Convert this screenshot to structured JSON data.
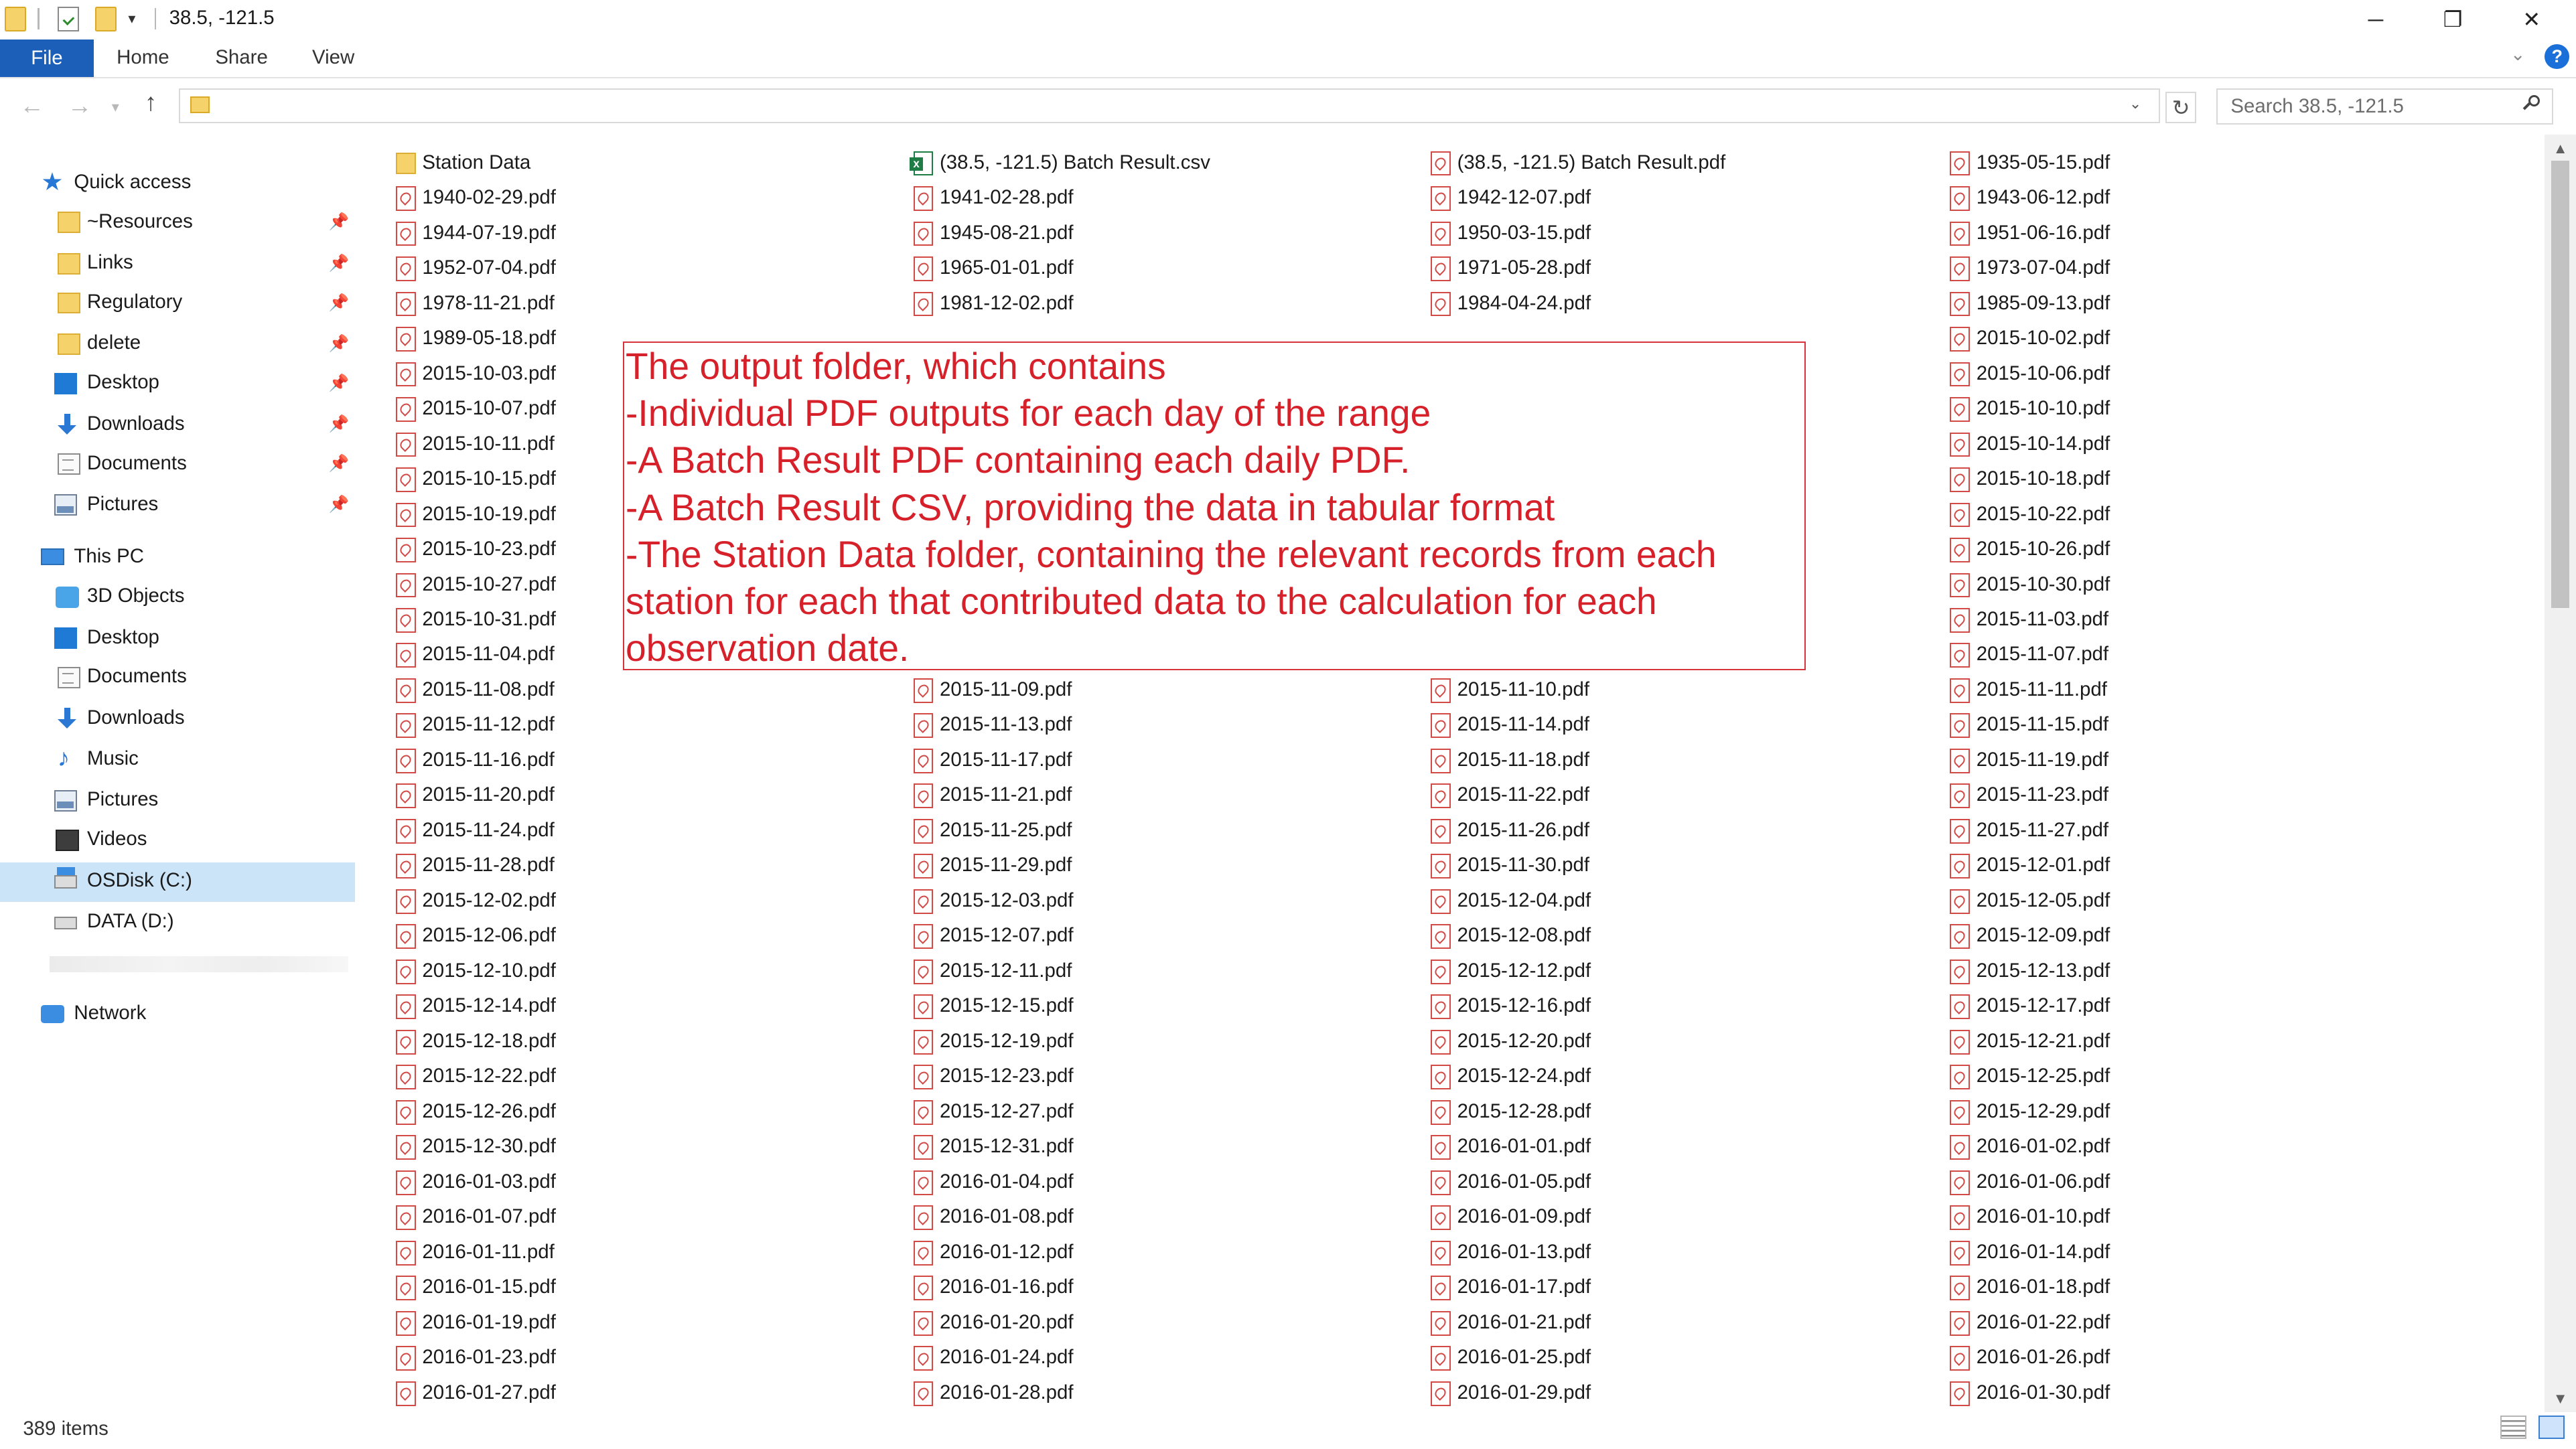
{
  "window": {
    "title": "38.5, -121.5",
    "quick_access_dropdown": "▾",
    "minimize": "─",
    "restore": "❐",
    "close": "✕"
  },
  "ribbon": {
    "file_tab": "File",
    "tabs": [
      "Home",
      "Share",
      "View"
    ],
    "help": "?"
  },
  "address": {
    "back": "←",
    "forward": "→",
    "recent": "▾",
    "up": "↑",
    "dropdown": "⌄",
    "refresh": "↻",
    "search_placeholder": "Search 38.5, -121.5"
  },
  "sidebar": {
    "quick_access": "Quick access",
    "pinned": [
      {
        "label": "~Resources",
        "icon": "folder-icon"
      },
      {
        "label": "Links",
        "icon": "folder-icon"
      },
      {
        "label": "Regulatory",
        "icon": "folder-icon"
      },
      {
        "label": "delete",
        "icon": "folder-icon"
      },
      {
        "label": "Desktop",
        "icon": "desktop-icon"
      },
      {
        "label": "Downloads",
        "icon": "downloads-icon"
      },
      {
        "label": "Documents",
        "icon": "documents-icon"
      },
      {
        "label": "Pictures",
        "icon": "pictures-icon"
      }
    ],
    "this_pc": "This PC",
    "pc_items": [
      {
        "label": "3D Objects",
        "icon": "3d-objects-icon"
      },
      {
        "label": "Desktop",
        "icon": "desktop-icon"
      },
      {
        "label": "Documents",
        "icon": "documents-icon"
      },
      {
        "label": "Downloads",
        "icon": "downloads-icon"
      },
      {
        "label": "Music",
        "icon": "music-icon"
      },
      {
        "label": "Pictures",
        "icon": "pictures-icon"
      },
      {
        "label": "Videos",
        "icon": "videos-icon"
      },
      {
        "label": "OSDisk (C:)",
        "icon": "drive-c-icon"
      },
      {
        "label": "DATA (D:)",
        "icon": "drive-icon"
      }
    ],
    "network": "Network",
    "pin_glyph": "📌"
  },
  "files": [
    [
      "Station Data",
      "(38.5, -121.5) Batch Result.csv",
      "(38.5, -121.5) Batch Result.pdf",
      "1935-05-15.pdf"
    ],
    [
      "1940-02-29.pdf",
      "1941-02-28.pdf",
      "1942-12-07.pdf",
      "1943-06-12.pdf"
    ],
    [
      "1944-07-19.pdf",
      "1945-08-21.pdf",
      "1950-03-15.pdf",
      "1951-06-16.pdf"
    ],
    [
      "1952-07-04.pdf",
      "1965-01-01.pdf",
      "1971-05-28.pdf",
      "1973-07-04.pdf"
    ],
    [
      "1978-11-21.pdf",
      "1981-12-02.pdf",
      "1984-04-24.pdf",
      "1985-09-13.pdf"
    ],
    [
      "1989-05-18.pdf",
      "",
      "",
      "2015-10-02.pdf"
    ],
    [
      "2015-10-03.pdf",
      "",
      "",
      "2015-10-06.pdf"
    ],
    [
      "2015-10-07.pdf",
      "",
      "",
      "2015-10-10.pdf"
    ],
    [
      "2015-10-11.pdf",
      "",
      "",
      "2015-10-14.pdf"
    ],
    [
      "2015-10-15.pdf",
      "",
      "",
      "2015-10-18.pdf"
    ],
    [
      "2015-10-19.pdf",
      "",
      "",
      "2015-10-22.pdf"
    ],
    [
      "2015-10-23.pdf",
      "",
      "",
      "2015-10-26.pdf"
    ],
    [
      "2015-10-27.pdf",
      "",
      "",
      "2015-10-30.pdf"
    ],
    [
      "2015-10-31.pdf",
      "",
      "",
      "2015-11-03.pdf"
    ],
    [
      "2015-11-04.pdf",
      "",
      "",
      "2015-11-07.pdf"
    ],
    [
      "2015-11-08.pdf",
      "2015-11-09.pdf",
      "2015-11-10.pdf",
      "2015-11-11.pdf"
    ],
    [
      "2015-11-12.pdf",
      "2015-11-13.pdf",
      "2015-11-14.pdf",
      "2015-11-15.pdf"
    ],
    [
      "2015-11-16.pdf",
      "2015-11-17.pdf",
      "2015-11-18.pdf",
      "2015-11-19.pdf"
    ],
    [
      "2015-11-20.pdf",
      "2015-11-21.pdf",
      "2015-11-22.pdf",
      "2015-11-23.pdf"
    ],
    [
      "2015-11-24.pdf",
      "2015-11-25.pdf",
      "2015-11-26.pdf",
      "2015-11-27.pdf"
    ],
    [
      "2015-11-28.pdf",
      "2015-11-29.pdf",
      "2015-11-30.pdf",
      "2015-12-01.pdf"
    ],
    [
      "2015-12-02.pdf",
      "2015-12-03.pdf",
      "2015-12-04.pdf",
      "2015-12-05.pdf"
    ],
    [
      "2015-12-06.pdf",
      "2015-12-07.pdf",
      "2015-12-08.pdf",
      "2015-12-09.pdf"
    ],
    [
      "2015-12-10.pdf",
      "2015-12-11.pdf",
      "2015-12-12.pdf",
      "2015-12-13.pdf"
    ],
    [
      "2015-12-14.pdf",
      "2015-12-15.pdf",
      "2015-12-16.pdf",
      "2015-12-17.pdf"
    ],
    [
      "2015-12-18.pdf",
      "2015-12-19.pdf",
      "2015-12-20.pdf",
      "2015-12-21.pdf"
    ],
    [
      "2015-12-22.pdf",
      "2015-12-23.pdf",
      "2015-12-24.pdf",
      "2015-12-25.pdf"
    ],
    [
      "2015-12-26.pdf",
      "2015-12-27.pdf",
      "2015-12-28.pdf",
      "2015-12-29.pdf"
    ],
    [
      "2015-12-30.pdf",
      "2015-12-31.pdf",
      "2016-01-01.pdf",
      "2016-01-02.pdf"
    ],
    [
      "2016-01-03.pdf",
      "2016-01-04.pdf",
      "2016-01-05.pdf",
      "2016-01-06.pdf"
    ],
    [
      "2016-01-07.pdf",
      "2016-01-08.pdf",
      "2016-01-09.pdf",
      "2016-01-10.pdf"
    ],
    [
      "2016-01-11.pdf",
      "2016-01-12.pdf",
      "2016-01-13.pdf",
      "2016-01-14.pdf"
    ],
    [
      "2016-01-15.pdf",
      "2016-01-16.pdf",
      "2016-01-17.pdf",
      "2016-01-18.pdf"
    ],
    [
      "2016-01-19.pdf",
      "2016-01-20.pdf",
      "2016-01-21.pdf",
      "2016-01-22.pdf"
    ],
    [
      "2016-01-23.pdf",
      "2016-01-24.pdf",
      "2016-01-25.pdf",
      "2016-01-26.pdf"
    ],
    [
      "2016-01-27.pdf",
      "2016-01-28.pdf",
      "2016-01-29.pdf",
      "2016-01-30.pdf"
    ]
  ],
  "annotation": {
    "lines": [
      "The output folder, which contains",
      "-Individual PDF outputs for each day of the range",
      "-A Batch Result PDF containing each daily PDF.",
      "-A Batch Result CSV, providing the data in tabular format",
      "-The Station Data folder, containing the relevant records from each",
      "station for each that contributed data to the calculation for each",
      "observation date."
    ],
    "color": "#d6202a"
  },
  "scrollbar": {
    "up": "▲",
    "down": "▼"
  },
  "status": {
    "item_count": "389 items"
  },
  "colors": {
    "accent": "#1b5fb8",
    "selection": "#cce4f7",
    "pdf_red": "#d24a46"
  }
}
